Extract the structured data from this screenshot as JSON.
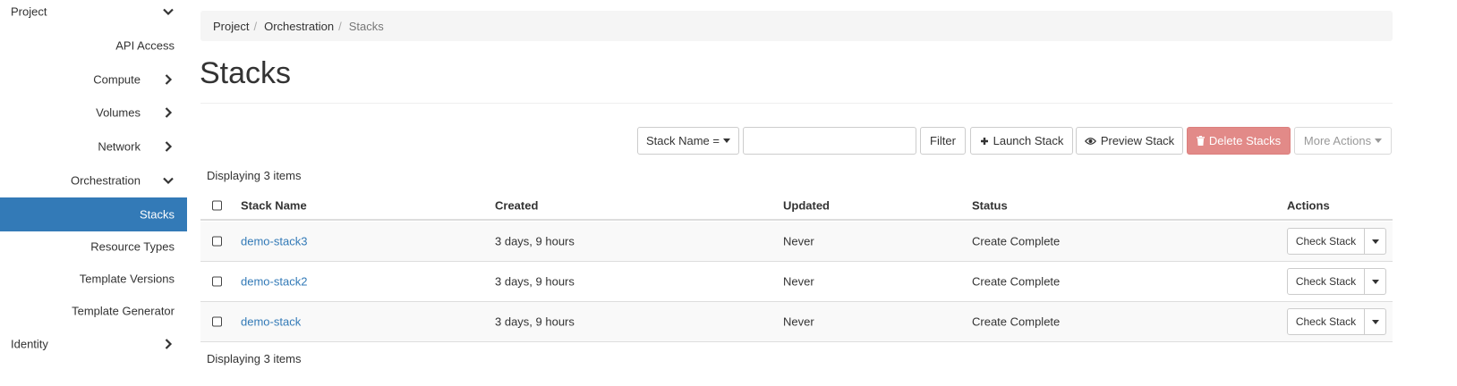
{
  "sidebar": {
    "items": [
      {
        "label": "Project",
        "level": 0,
        "chevron": "down"
      },
      {
        "label": "API Access",
        "level": 2,
        "chevron": null
      },
      {
        "label": "Compute",
        "level": 1,
        "chevron": "right"
      },
      {
        "label": "Volumes",
        "level": 1,
        "chevron": "right"
      },
      {
        "label": "Network",
        "level": 1,
        "chevron": "right"
      },
      {
        "label": "Orchestration",
        "level": 1,
        "chevron": "down"
      },
      {
        "label": "Stacks",
        "level": 2,
        "chevron": null,
        "active": true
      },
      {
        "label": "Resource Types",
        "level": 2,
        "chevron": null
      },
      {
        "label": "Template Versions",
        "level": 2,
        "chevron": null
      },
      {
        "label": "Template Generator",
        "level": 2,
        "chevron": null
      },
      {
        "label": "Identity",
        "level": 0,
        "chevron": "right"
      }
    ]
  },
  "breadcrumb": [
    "Project",
    "Orchestration",
    "Stacks"
  ],
  "page_title": "Stacks",
  "toolbar": {
    "filter_field_label": "Stack Name =",
    "filter_value": "",
    "filter_button": "Filter",
    "launch_button": "Launch Stack",
    "preview_button": "Preview Stack",
    "delete_button": "Delete Stacks",
    "more_actions_button": "More Actions"
  },
  "count_text": "Displaying 3 items",
  "table": {
    "columns": [
      "Stack Name",
      "Created",
      "Updated",
      "Status",
      "Actions"
    ],
    "rows": [
      {
        "name": "demo-stack3",
        "created": "3 days, 9 hours",
        "updated": "Never",
        "status": "Create Complete",
        "action": "Check Stack"
      },
      {
        "name": "demo-stack2",
        "created": "3 days, 9 hours",
        "updated": "Never",
        "status": "Create Complete",
        "action": "Check Stack"
      },
      {
        "name": "demo-stack",
        "created": "3 days, 9 hours",
        "updated": "Never",
        "status": "Create Complete",
        "action": "Check Stack"
      }
    ]
  },
  "colors": {
    "accent": "#337ab7",
    "danger": "#e28a88",
    "row_stripe": "#f9f9f9",
    "breadcrumb_bg": "#f5f5f5"
  },
  "icons": {
    "launch": "plus-icon",
    "preview": "eye-icon",
    "delete": "trash-icon",
    "expand": "chevron-down-icon",
    "collapse": "chevron-right-icon"
  }
}
